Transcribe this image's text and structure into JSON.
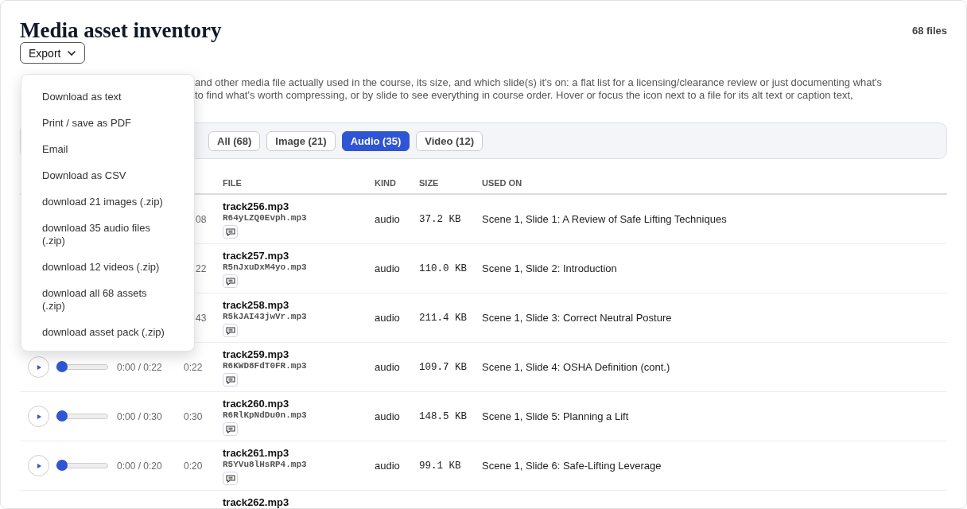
{
  "title": "Media asset inventory",
  "file_count": "68 files",
  "export_button": "Export",
  "export_menu": [
    "Download as text",
    "Print / save as PDF",
    "Email",
    "Download as CSV",
    "download 21 images (.zip)",
    "download 35 audio files (.zip)",
    "download 12 videos (.zip)",
    "download all 68 assets (.zip)",
    "download asset pack (.zip)"
  ],
  "description_lines": [
    "and other media file actually used in the course, its size, and which slide(s) it's on: a flat list for a licensing/clearance review or just documenting what's",
    "to find what's worth compressing, or by slide to see everything in course order. Hover or focus the icon next to a file for its alt text or caption text,"
  ],
  "filters": [
    {
      "label": "All (68)",
      "selected": false
    },
    {
      "label": "Image (21)",
      "selected": false
    },
    {
      "label": "Audio (35)",
      "selected": true
    },
    {
      "label": "Video (12)",
      "selected": false
    }
  ],
  "columns": [
    "FILE",
    "KIND",
    "SIZE",
    "USED ON"
  ],
  "rows": [
    {
      "duration": "08",
      "file": "track256.mp3",
      "source": "R64yLZQ0Evph.mp3",
      "kind": "audio",
      "size": "37.2 KB",
      "used_on": "Scene 1, Slide 1: A Review of Safe Lifting Techniques"
    },
    {
      "duration": "22",
      "file": "track257.mp3",
      "source": "R5nJxuDxM4yo.mp3",
      "kind": "audio",
      "size": "110.0 KB",
      "used_on": "Scene 1, Slide 2: Introduction"
    },
    {
      "duration": "43",
      "file": "track258.mp3",
      "source": "R5kJAI43jwVr.mp3",
      "kind": "audio",
      "size": "211.4 KB",
      "used_on": "Scene 1, Slide 3: Correct Neutral Posture"
    },
    {
      "player": {
        "level": 0,
        "time": "0:00 / 0:22"
      },
      "duration": "0:22",
      "file": "track259.mp3",
      "source": "R6KWD8FdT0FR.mp3",
      "kind": "audio",
      "size": "109.7 KB",
      "used_on": "Scene 1, Slide 4: OSHA Definition (cont.)"
    },
    {
      "player": {
        "level": 0,
        "time": "0:00 / 0:30"
      },
      "duration": "0:30",
      "file": "track260.mp3",
      "source": "R6RlKpNdDu0n.mp3",
      "kind": "audio",
      "size": "148.5 KB",
      "used_on": "Scene 1, Slide 5: Planning a Lift"
    },
    {
      "player": {
        "level": 0,
        "time": "0:00 / 0:20"
      },
      "duration": "0:20",
      "file": "track261.mp3",
      "source": "R5YVu8lHsRP4.mp3",
      "kind": "audio",
      "size": "99.1 KB",
      "used_on": "Scene 1, Slide 6: Safe-Lifting Leverage"
    },
    {
      "file": "track262.mp3"
    }
  ]
}
